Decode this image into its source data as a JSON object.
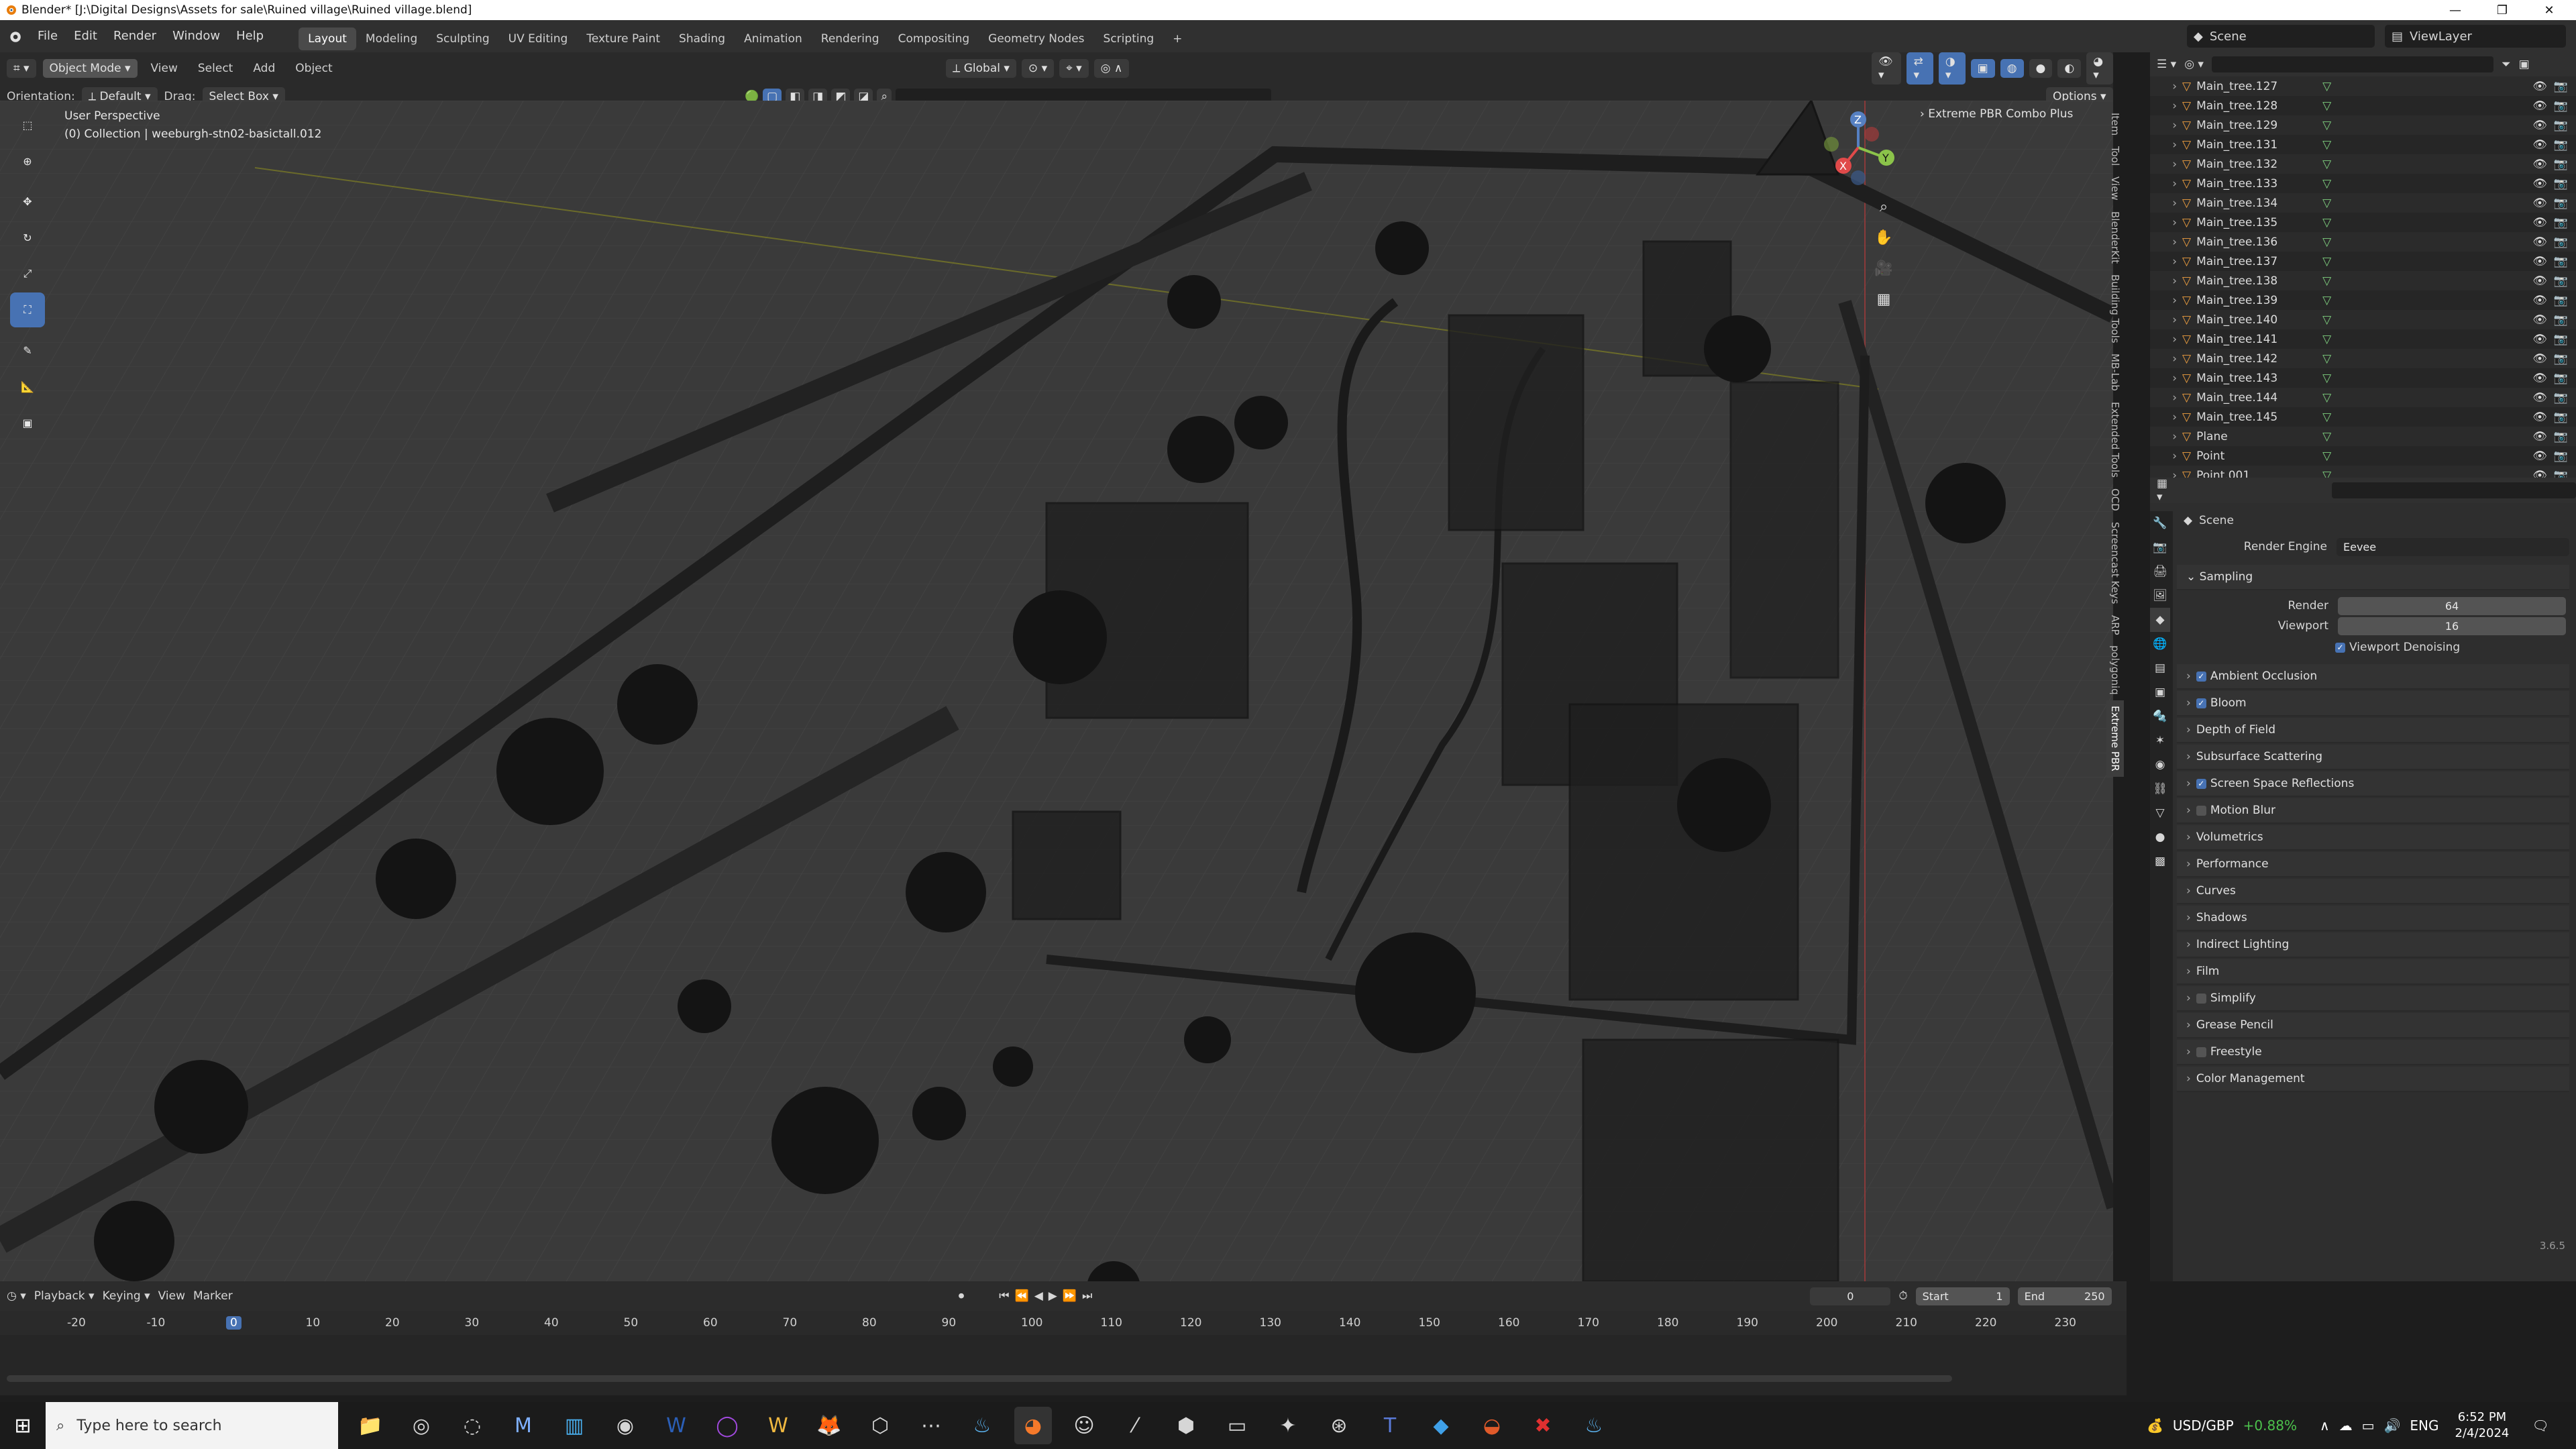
{
  "window": {
    "title": "Blender* [J:\\Digital Designs\\Assets for sale\\Ruined village\\Ruined village.blend]",
    "controls": [
      "—",
      "❐",
      "✕"
    ]
  },
  "menubar": {
    "menus": [
      "File",
      "Edit",
      "Render",
      "Window",
      "Help"
    ],
    "workspaces": [
      "Layout",
      "Modeling",
      "Sculpting",
      "UV Editing",
      "Texture Paint",
      "Shading",
      "Animation",
      "Rendering",
      "Compositing",
      "Geometry Nodes",
      "Scripting"
    ],
    "active_workspace": "Layout",
    "scene": "Scene",
    "view_layer": "ViewLayer"
  },
  "viewport_header": {
    "mode": "Object Mode",
    "menus": [
      "View",
      "Select",
      "Add",
      "Object"
    ],
    "transform": "Global",
    "orientation_label": "Orientation:",
    "orientation_value": "Default",
    "drag_label": "Drag:",
    "drag_value": "Select Box",
    "options": "Options"
  },
  "viewport": {
    "perspective": "User Perspective",
    "collection_info": "(0) Collection | weeburgh-stn02-basictall.012",
    "addon_panel": "Extreme PBR Combo Plus",
    "gizmo_axes": [
      "X",
      "Y",
      "Z"
    ],
    "n_tabs": [
      "Item",
      "Tool",
      "View",
      "BlenderKit",
      "Building Tools",
      "MB-Lab",
      "Extended Tools",
      "OCD",
      "Screencast Keys",
      "ARP",
      "polygoniq",
      "Extreme PBR"
    ]
  },
  "outliner": {
    "items": [
      "Main_tree.127",
      "Main_tree.128",
      "Main_tree.129",
      "Main_tree.131",
      "Main_tree.132",
      "Main_tree.133",
      "Main_tree.134",
      "Main_tree.135",
      "Main_tree.136",
      "Main_tree.137",
      "Main_tree.138",
      "Main_tree.139",
      "Main_tree.140",
      "Main_tree.141",
      "Main_tree.142",
      "Main_tree.143",
      "Main_tree.144",
      "Main_tree.145",
      "Plane",
      "Point",
      "Point.001"
    ]
  },
  "properties": {
    "context": "Scene",
    "render_engine_label": "Render Engine",
    "render_engine": "Eevee",
    "sampling": "Sampling",
    "render_label": "Render",
    "render_samples": "64",
    "viewport_label": "Viewport",
    "viewport_samples": "16",
    "viewport_denoising": "Viewport Denoising",
    "panels": [
      {
        "label": "Ambient Occlusion",
        "checkbox": "on"
      },
      {
        "label": "Bloom",
        "checkbox": "on"
      },
      {
        "label": "Depth of Field",
        "checkbox": "none"
      },
      {
        "label": "Subsurface Scattering",
        "checkbox": "none"
      },
      {
        "label": "Screen Space Reflections",
        "checkbox": "on"
      },
      {
        "label": "Motion Blur",
        "checkbox": "off"
      },
      {
        "label": "Volumetrics",
        "checkbox": "none"
      },
      {
        "label": "Performance",
        "checkbox": "none"
      },
      {
        "label": "Curves",
        "checkbox": "none"
      },
      {
        "label": "Shadows",
        "checkbox": "none"
      },
      {
        "label": "Indirect Lighting",
        "checkbox": "none"
      },
      {
        "label": "Film",
        "checkbox": "none"
      },
      {
        "label": "Simplify",
        "checkbox": "off"
      },
      {
        "label": "Grease Pencil",
        "checkbox": "none"
      },
      {
        "label": "Freestyle",
        "checkbox": "off"
      },
      {
        "label": "Color Management",
        "checkbox": "none"
      }
    ],
    "version": "3.6.5"
  },
  "timeline": {
    "menus": [
      "Playback",
      "Keying",
      "View",
      "Marker"
    ],
    "current_frame": "0",
    "start_label": "Start",
    "start": "1",
    "end_label": "End",
    "end": "250",
    "ticks": [
      "-20",
      "-10",
      "0",
      "10",
      "20",
      "30",
      "40",
      "50",
      "60",
      "70",
      "80",
      "90",
      "100",
      "110",
      "120",
      "130",
      "140",
      "150",
      "160",
      "170",
      "180",
      "190",
      "200",
      "210",
      "220",
      "230"
    ]
  },
  "taskbar": {
    "search_placeholder": "Type here to search",
    "currency": "USD/GBP",
    "currency_change": "+0.88%",
    "lang": "ENG",
    "time": "6:52 PM",
    "date": "2/4/2024"
  }
}
